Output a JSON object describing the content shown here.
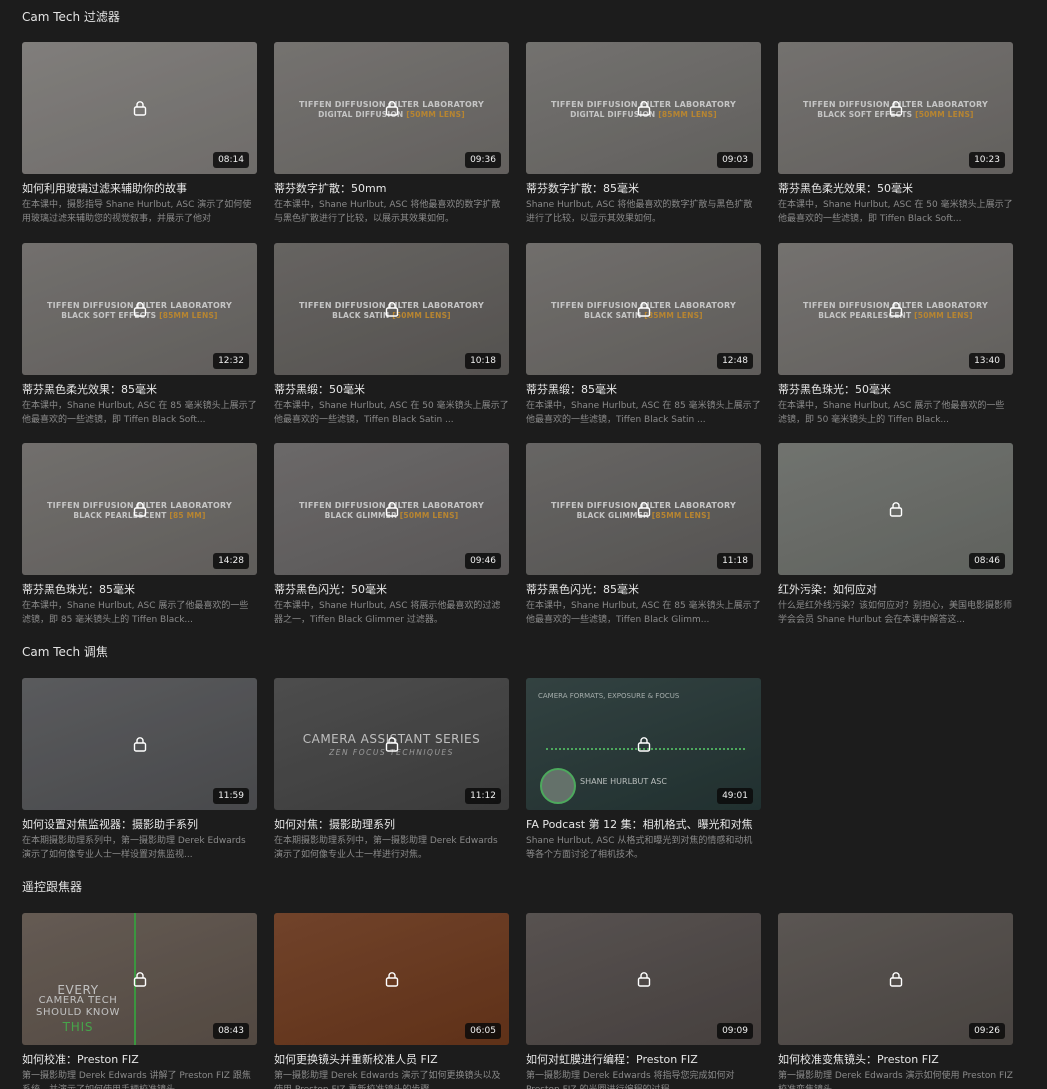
{
  "sections": [
    {
      "title": "Cam Tech 过滤器",
      "cards": [
        {
          "title": "如何利用玻璃过滤来辅助你的故事",
          "desc": "在本课中，摄影指导 Shane Hurlbut, ASC 演示了如何使用玻璃过滤来辅助您的视觉叙事，并展示了他对",
          "duration": "08:14",
          "bg": "#9d9a97"
        },
        {
          "title": "蒂芬数字扩散：50mm",
          "desc": "在本课中，Shane Hurlbut, ASC 将他最喜欢的数字扩散与黑色扩散进行了比较，以展示其效果如何。",
          "duration": "09:36",
          "bg": "#8f8c89",
          "banner1": "TIFFEN DIFFUSION FILTER LABORATORY",
          "banner2w": "DIGITAL DIFFUSION",
          "banner2o": "[50MM LENS]"
        },
        {
          "title": "蒂芬数字扩散：85毫米",
          "desc": "Shane Hurlbut, ASC 将他最喜欢的数字扩散与黑色扩散进行了比较，以显示其效果如何。",
          "duration": "09:03",
          "bg": "#8d8b88",
          "banner1": "TIFFEN DIFFUSION FILTER LABORATORY",
          "banner2w": "DIGITAL DIFFUSION",
          "banner2o": "[85MM LENS]"
        },
        {
          "title": "蒂芬黑色柔光效果：50毫米",
          "desc": "在本课中，Shane Hurlbut, ASC 在 50 毫米镜头上展示了他最喜欢的一些滤镜，即 Tiffen Black Soft...",
          "duration": "10:23",
          "bg": "#8e8b88",
          "banner1": "TIFFEN DIFFUSION FILTER LABORATORY",
          "banner2w": "BLACK SOFT EFFECTS",
          "banner2o": "[50MM LENS]"
        }
      ]
    },
    {
      "title": "",
      "cards": [
        {
          "title": "蒂芬黑色柔光效果：85毫米",
          "desc": "在本课中，Shane Hurlbut, ASC 在 85 毫米镜头上展示了他最喜欢的一些滤镜，即 Tiffen Black Soft...",
          "duration": "12:32",
          "bg": "#8c8986",
          "banner1": "TIFFEN DIFFUSION FILTER LABORATORY",
          "banner2w": "BLACK SOFT EFFECTS",
          "banner2o": "[85MM LENS]"
        },
        {
          "title": "蒂芬黑缎：50毫米",
          "desc": "在本课中，Shane Hurlbut, ASC 在 50 毫米镜头上展示了他最喜欢的一些滤镜，Tiffen Black Satin ...",
          "duration": "10:18",
          "bg": "#7d7a77",
          "banner1": "TIFFEN DIFFUSION FILTER LABORATORY",
          "banner2w": "BLACK SATIN",
          "banner2o": "[50MM LENS]"
        },
        {
          "title": "蒂芬黑缎：85毫米",
          "desc": "在本课中，Shane Hurlbut, ASC 在 85 毫米镜头上展示了他最喜欢的一些滤镜，Tiffen Black Satin ...",
          "duration": "12:48",
          "bg": "#8a8784",
          "banner1": "TIFFEN DIFFUSION FILTER LABORATORY",
          "banner2w": "BLACK SATIN",
          "banner2o": "[85MM LENS]"
        },
        {
          "title": "蒂芬黑色珠光：50毫米",
          "desc": "在本课中，Shane Hurlbut, ASC 展示了他最喜欢的一些滤镜，即 50 毫米镜头上的 Tiffen Black...",
          "duration": "13:40",
          "bg": "#8e8b88",
          "banner1": "TIFFEN DIFFUSION FILTER LABORATORY",
          "banner2w": "BLACK PEARLESCENT",
          "banner2o": "[50MM LENS]"
        }
      ]
    },
    {
      "title": "",
      "cards": [
        {
          "title": "蒂芬黑色珠光：85毫米",
          "desc": "在本课中，Shane Hurlbut, ASC 展示了他最喜欢的一些滤镜，即 85 毫米镜头上的 Tiffen Black...",
          "duration": "14:28",
          "bg": "#8b8885",
          "banner1": "TIFFEN DIFFUSION FILTER LABORATORY",
          "banner2w": "BLACK PEARLESCENT",
          "banner2o": "[85 MM]"
        },
        {
          "title": "蒂芬黑色闪光：50毫米",
          "desc": "在本课中，Shane Hurlbut, ASC 将展示他最喜欢的过滤器之一，Tiffen Black Glimmer 过滤器。",
          "duration": "09:46",
          "bg": "#838080",
          "banner1": "TIFFEN DIFFUSION FILTER LABORATORY",
          "banner2w": "BLACK GLIMMER",
          "banner2o": "[50MM LENS]"
        },
        {
          "title": "蒂芬黑色闪光：85毫米",
          "desc": "在本课中，Shane Hurlbut, ASC 在 85 毫米镜头上展示了他最喜欢的一些滤镜，Tiffen Black Glimm...",
          "duration": "11:18",
          "bg": "#7e7c7a",
          "banner1": "TIFFEN DIFFUSION FILTER LABORATORY",
          "banner2w": "BLACK GLIMMER",
          "banner2o": "[85MM LENS]"
        },
        {
          "title": "红外污染：如何应对",
          "desc": "什么是红外线污染？该如何应对？别担心，美国电影摄影师学会会员 Shane Hurlbut 会在本课中解答这...",
          "duration": "08:46",
          "bg": "#8a8d88"
        }
      ]
    },
    {
      "title": "Cam Tech 调焦",
      "cards": [
        {
          "title": "如何设置对焦监视器：摄影助手系列",
          "desc": "在本期摄影助理系列中，第一摄影助理 Derek Edwards 演示了如何像专业人士一样设置对焦监视...",
          "duration": "11:59",
          "bg": "#6e6f72"
        },
        {
          "title": "如何对焦：摄影助理系列",
          "desc": "在本期摄影助理系列中，第一摄影助理 Derek Edwards 演示了如何像专业人士一样进行对焦。",
          "duration": "11:12",
          "bg": "#5e5e5e",
          "caTitle": "CAMERA ASSISTANT SERIES",
          "caSub": "ZEN FOCUS TECHNIQUES"
        },
        {
          "title": "FA Podcast 第 12 集：相机格式、曝光和对焦",
          "desc": "Shane Hurlbut, ASC 从格式和曝光到对焦的情感和动机等各个方面讨论了相机技术。",
          "duration": "49:01",
          "bg": "#3e5150",
          "podTop": "CAMERA FORMATS, EXPOSURE & FOCUS",
          "podName": "SHANE HURLBUT ASC"
        }
      ]
    },
    {
      "title": "遥控跟焦器",
      "cards": [
        {
          "title": "如何校准：Preston FIZ",
          "desc": "第一摄影助理 Derek Edwards 讲解了 Preston FIZ 跟焦系统，并演示了如何使用手柄校准镜头。",
          "duration": "08:43",
          "bg": "#7b6f66",
          "everyLines": [
            "EVERY",
            "CAMERA TECH",
            "SHOULD KNOW"
          ],
          "everyHighlight": "THIS"
        },
        {
          "title": "如何更换镜头并重新校准人员 FIZ",
          "desc": "第一摄影助理 Derek Edwards 演示了如何更换镜头以及使用 Preston FIZ 重新校准镜头的步骤。",
          "duration": "06:05",
          "bg": "#8a5234"
        },
        {
          "title": "如何对虹膜进行编程：Preston FIZ",
          "desc": "第一摄影助理 Derek Edwards 将指导您完成如何对 Preston FIZ 的光圈进行编程的过程。",
          "duration": "09:09",
          "bg": "#6b6462"
        },
        {
          "title": "如何校准变焦镜头：Preston FIZ",
          "desc": "第一摄影助理 Derek Edwards 演示如何使用 Preston FIZ 校准变焦镜头。",
          "duration": "09:26",
          "bg": "#6f6965"
        }
      ]
    }
  ]
}
